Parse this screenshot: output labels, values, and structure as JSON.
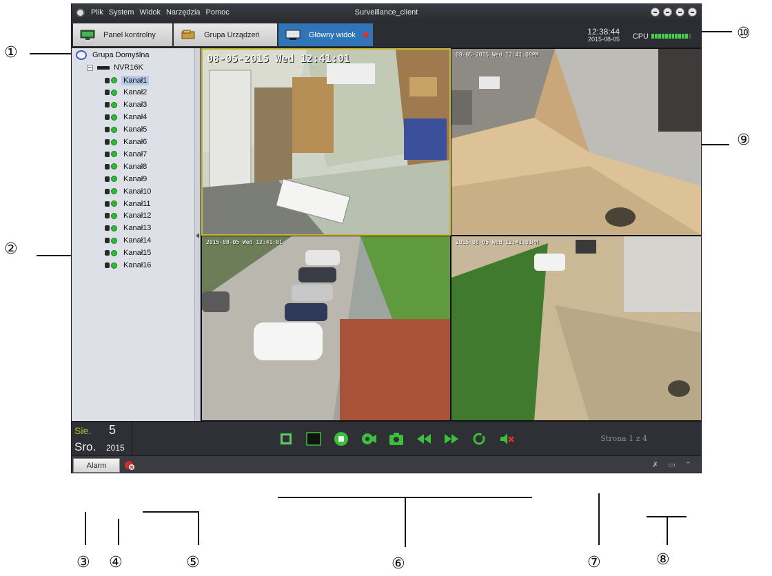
{
  "callouts": {
    "c1": "①",
    "c2": "②",
    "c3": "③",
    "c4": "④",
    "c5": "⑤",
    "c6": "⑥",
    "c7": "⑦",
    "c8": "⑧",
    "c9": "⑨",
    "c10": "⑩"
  },
  "titlebar": {
    "menu": [
      "Plik",
      "System",
      "Widok",
      "Narzędzia",
      "Pomoc"
    ],
    "title": "Surveillance_client"
  },
  "tabs": {
    "panel": "Panel kontrolny",
    "grupa": "Grupa Urządzeń",
    "glowny": "Główny widok"
  },
  "status": {
    "time": "12:38:44",
    "date": "2015-08-05",
    "cpu_label": "CPU",
    "cpu_level": 0.9
  },
  "tree": {
    "root": "Grupa Domyślna",
    "device": "NVR16K",
    "selected_channel": "Kanał1",
    "channels": [
      "Kanał1",
      "Kanał2",
      "Kanał3",
      "Kanał4",
      "Kanał5",
      "Kanał6",
      "Kanał7",
      "Kanał8",
      "Kanał9",
      "Kanał10",
      "Kanał11",
      "Kanał12",
      "Kanał13",
      "Kanał14",
      "Kanał15",
      "Kanał16"
    ]
  },
  "video": {
    "tile1_osd": "08-05-2015 Wed 12:41:01",
    "tile2_osd": "08-05-2015 Wed 12:41:00PM",
    "tile3_osd": "2015-08-05 Wed 12:41:01",
    "tile4_osd": "2015-08-05 Wed 12:41:01PM"
  },
  "datebox": {
    "month": "Sie.",
    "day": "5",
    "weekday": "Sro.",
    "year": "2015"
  },
  "controls": {
    "icons": [
      "fullscreen-icon",
      "single-view-icon",
      "stop-icon",
      "record-icon",
      "snapshot-icon",
      "previous-page-icon",
      "next-page-icon",
      "cycle-icon",
      "mute-icon"
    ],
    "page_indicator": "Strona 1 z 4"
  },
  "statusbar": {
    "alarm_label": "Alarm",
    "pin_glyph": "✗",
    "window_glyph": "▭",
    "collapse_glyph": "⌃"
  },
  "colors": {
    "accent": "#2f75b8",
    "active_border": "#c9b93a",
    "control_green": "#3bbf3d",
    "month_green": "#b2c232"
  }
}
